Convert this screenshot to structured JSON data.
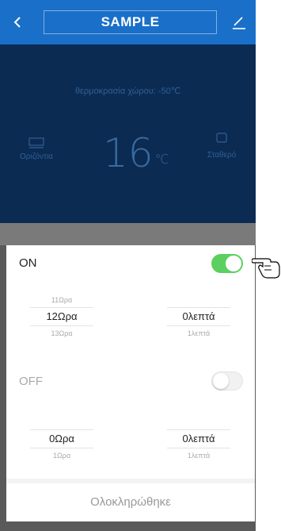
{
  "header": {
    "title": "SAMPLE",
    "back_icon": "chevron-left-icon",
    "edit_icon": "edit-icon"
  },
  "status": {
    "room_temp_text": "θερμοκρασία χώρου: -50℃",
    "mode_left": "Οριζόντια",
    "mode_right": "Σταθερό",
    "setpoint": "16",
    "setpoint_unit": "℃"
  },
  "timer_on": {
    "label": "ON",
    "enabled": true,
    "hours": {
      "prev": "11Ωρα",
      "selected": "12Ωρα",
      "next": "13Ωρα"
    },
    "minutes": {
      "prev": "",
      "selected": "0λεπτά",
      "next": "1λεπτά"
    }
  },
  "timer_off": {
    "label": "OFF",
    "enabled": false,
    "hours": {
      "prev": "",
      "selected": "0Ωρα",
      "next": "1Ωρα"
    },
    "minutes": {
      "prev": "",
      "selected": "0λεπτά",
      "next": "1λεπτά"
    }
  },
  "done_label": "Ολοκληρώθηκε",
  "colors": {
    "header": "#1a6fc9",
    "panel": "#0c2b52",
    "toggle_on": "#5bd05f"
  }
}
